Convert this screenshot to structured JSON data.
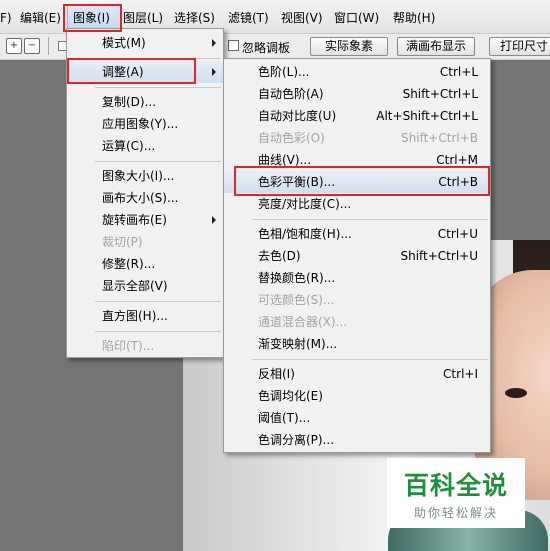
{
  "menubar": {
    "file_partial": "F)",
    "edit": "编辑(E)",
    "image": "图象(I)",
    "layer": "图层(L)",
    "select": "选择(S)",
    "filter": "滤镜(T)",
    "view": "视图(V)",
    "window": "窗口(W)",
    "help": "帮助(H)"
  },
  "options": {
    "ignore_palettes": "忽略调板",
    "actual_pixels": "实际象素",
    "fit_screen": "满画布显示",
    "print_size": "打印尺寸"
  },
  "image_menu": {
    "mode": "模式(M)",
    "adjust": "调整(A)",
    "duplicate": "复制(D)...",
    "apply_image": "应用图象(Y)...",
    "calculations": "运算(C)...",
    "image_size": "图象大小(I)...",
    "canvas_size": "画布大小(S)...",
    "rotate_canvas": "旋转画布(E)",
    "crop": "裁切(P)",
    "trim": "修整(R)...",
    "reveal_all": "显示全部(V)",
    "histogram": "直方图(H)...",
    "trap": "陷印(T)..."
  },
  "adjust_menu": {
    "levels": "色阶(L)...",
    "levels_sc": "Ctrl+L",
    "auto_levels": "自动色阶(A)",
    "auto_levels_sc": "Shift+Ctrl+L",
    "auto_contrast": "自动对比度(U)",
    "auto_contrast_sc": "Alt+Shift+Ctrl+L",
    "auto_color": "自动色彩(O)",
    "auto_color_sc": "Shift+Ctrl+B",
    "curves": "曲线(V)...",
    "curves_sc": "Ctrl+M",
    "color_balance": "色彩平衡(B)...",
    "color_balance_sc": "Ctrl+B",
    "brightness_contrast": "亮度/对比度(C)...",
    "hue_saturation": "色相/饱和度(H)...",
    "hue_saturation_sc": "Ctrl+U",
    "desaturate": "去色(D)",
    "desaturate_sc": "Shift+Ctrl+U",
    "replace_color": "替换颜色(R)...",
    "selective_color": "可选颜色(S)...",
    "channel_mixer": "通道混合器(X)...",
    "gradient_map": "渐变映射(M)...",
    "invert": "反相(I)",
    "invert_sc": "Ctrl+I",
    "equalize": "色调均化(E)",
    "threshold": "阈值(T)...",
    "posterize": "色调分离(P)..."
  },
  "watermark": {
    "title": "百科全说",
    "subtitle": "助你轻松解决"
  },
  "colors": {
    "highlight_box": "#e0242a",
    "watermark_green": "#1f8f3d"
  }
}
